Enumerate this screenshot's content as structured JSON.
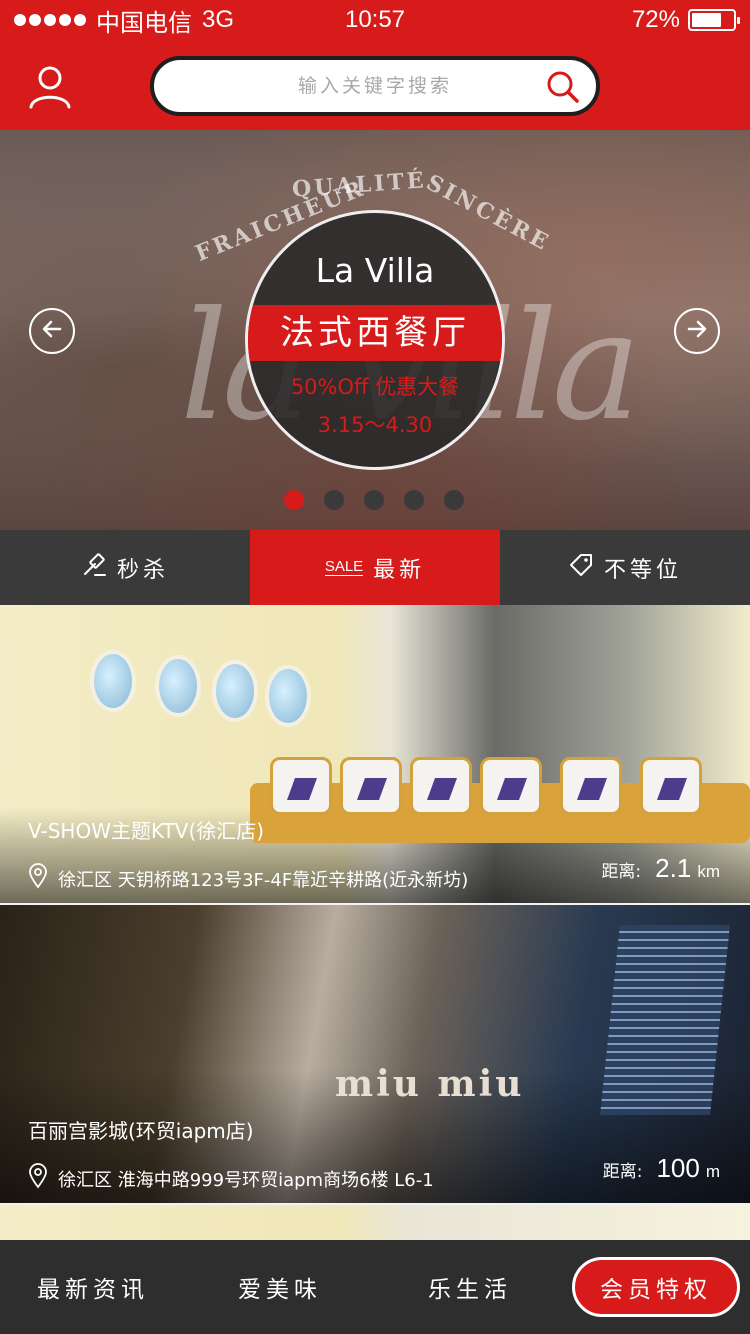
{
  "status_bar": {
    "carrier": "中国电信",
    "network": "3G",
    "time": "10:57",
    "battery_percent": "72%",
    "battery_level": 0.72
  },
  "header": {
    "search_placeholder": "输入关键字搜索",
    "user_icon": "user-icon",
    "search_icon": "search-icon"
  },
  "banner": {
    "brand": "La Villa",
    "title": "法式西餐厅",
    "promo": "50%Off 优惠大餐",
    "dates": "3.15～4.30",
    "bg_word_1": "QUALITÉ",
    "bg_word_2": "SINCÈRE",
    "bg_word_3": "FRAICHEUR",
    "bg_script": "la villa",
    "slide_count": 5,
    "active_slide": 1
  },
  "tabs": [
    {
      "label": "秒杀",
      "icon": "hammer-icon"
    },
    {
      "label": "最新",
      "tag": "SALE",
      "active": true
    },
    {
      "label": "不等位",
      "icon": "tag-icon"
    }
  ],
  "cards": [
    {
      "title": "V-SHOW主题KTV(徐汇店)",
      "address": "徐汇区 天钥桥路123号3F-4F靠近辛耕路(近永新坊)",
      "distance_label": "距离:",
      "distance_value": "2.1",
      "distance_unit": "km"
    },
    {
      "title": "百丽宫影城(环贸iapm店)",
      "address": "徐汇区 淮海中路999号环贸iapm商场6楼 L6-1",
      "distance_label": "距离:",
      "distance_value": "100",
      "distance_unit": "m",
      "sign": "miu miu"
    }
  ],
  "bottom_nav": [
    {
      "label": "最新资讯"
    },
    {
      "label": "爱美味"
    },
    {
      "label": "乐生活"
    },
    {
      "label": "会员特权",
      "highlighted": true
    }
  ],
  "colors": {
    "brand_red": "#d71a1a",
    "dark_bar": "#3a3a3a",
    "nav_bg": "#2e2e2e"
  }
}
